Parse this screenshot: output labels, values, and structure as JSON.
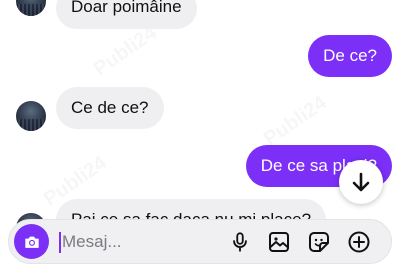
{
  "messages": [
    {
      "id": "m1",
      "direction": "incoming",
      "text": "Doar poimâine"
    },
    {
      "id": "m2",
      "direction": "outgoing",
      "text": "De ce?"
    },
    {
      "id": "m3",
      "direction": "incoming",
      "text": "Ce de ce?"
    },
    {
      "id": "m4",
      "direction": "outgoing",
      "text": "De ce sa placi?"
    },
    {
      "id": "m5",
      "direction": "incoming",
      "text": "Pai ce sa fac daca nu mi place?"
    }
  ],
  "composer": {
    "placeholder": "Mesaj...",
    "value": ""
  },
  "watermark": "Publi24",
  "colors": {
    "accent": "#7b2ff7",
    "incoming_bubble": "#efeff2",
    "outgoing_text": "#ffffff"
  },
  "icons": [
    "camera-icon",
    "microphone-icon",
    "image-gallery-icon",
    "sticker-icon",
    "plus-icon",
    "arrow-down-icon"
  ]
}
